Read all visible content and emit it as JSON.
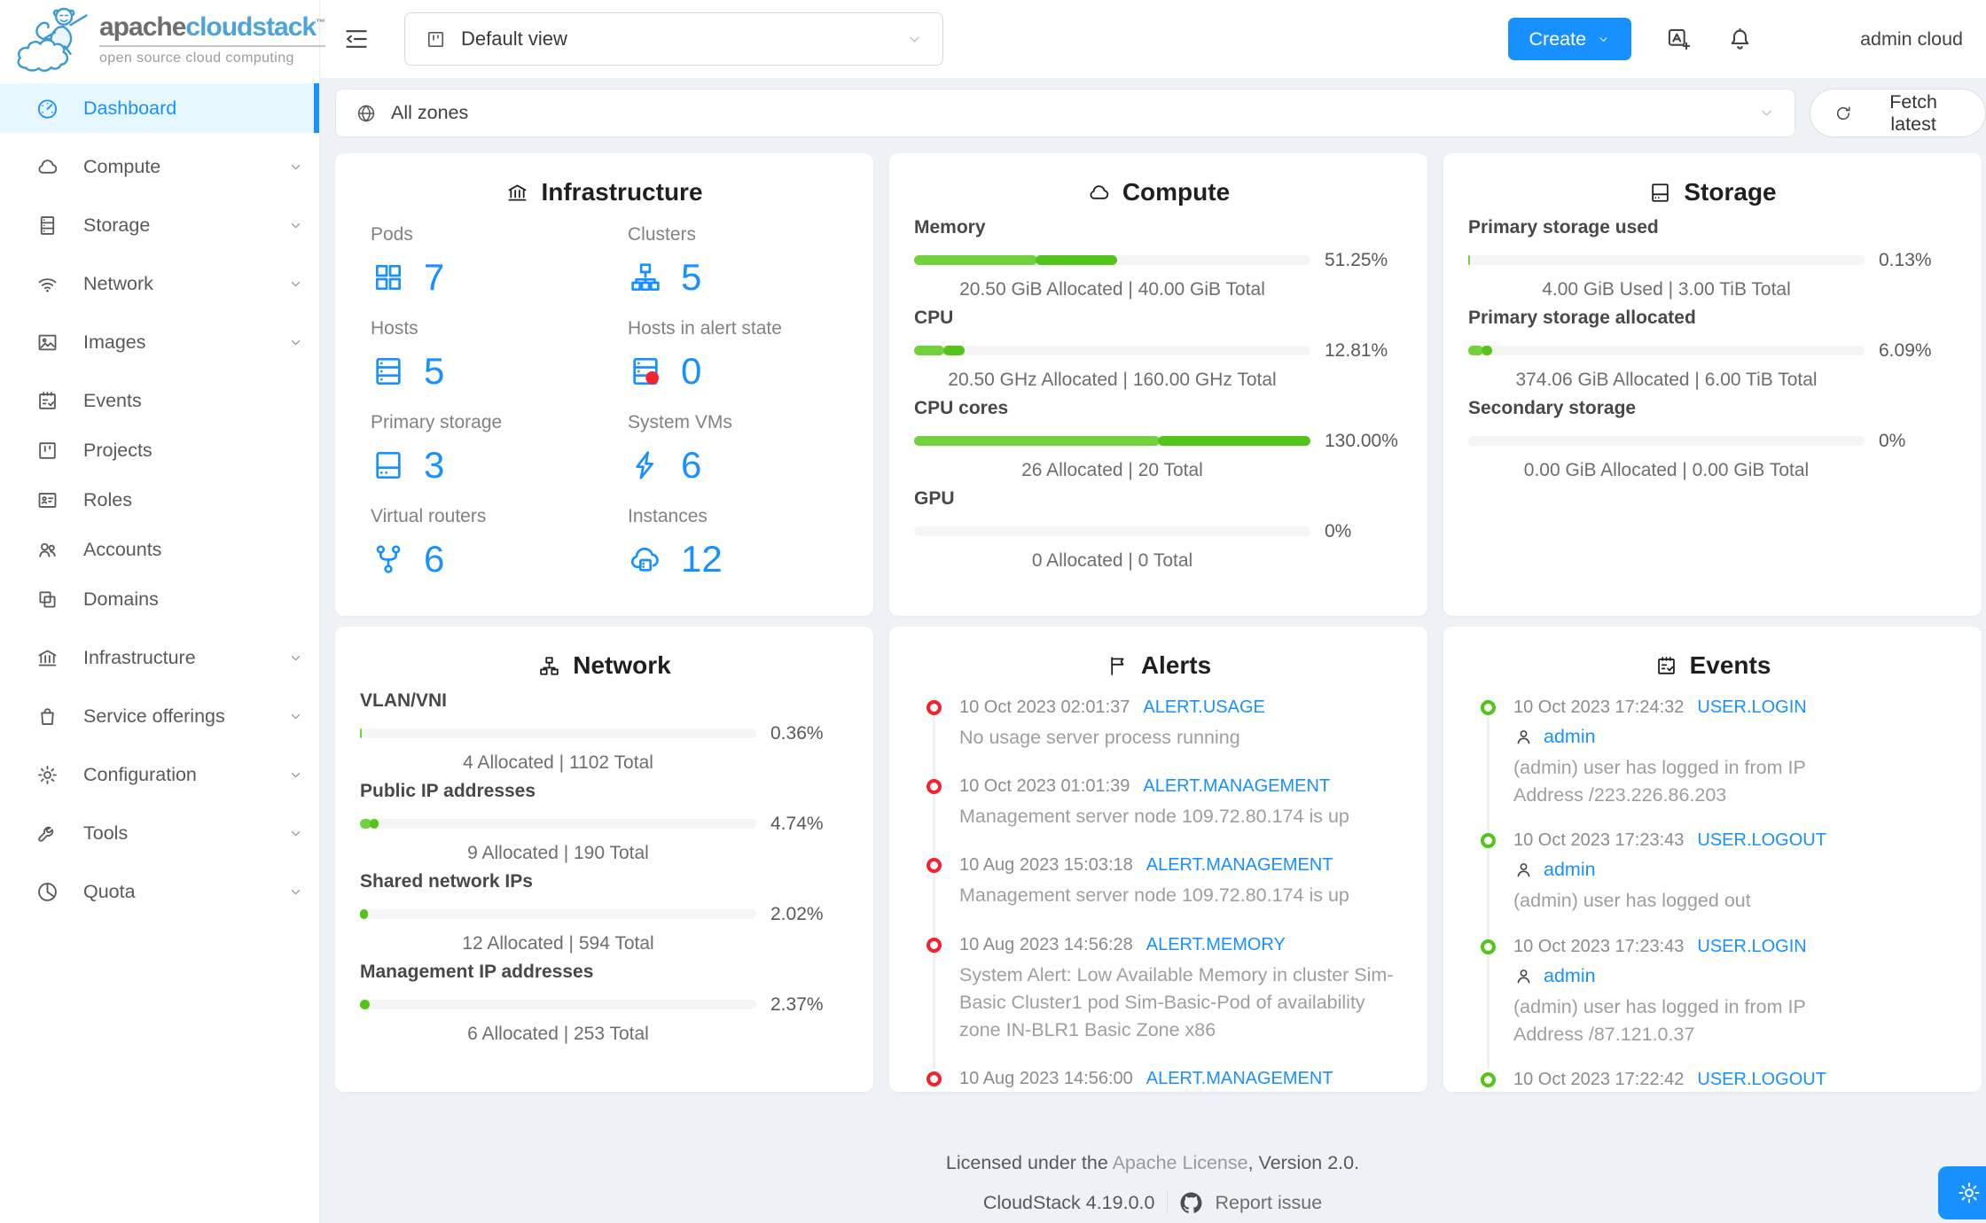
{
  "sidebar": {
    "logo": {
      "brand_primary": "apache",
      "brand_secondary": "cloudstack",
      "trademark": "TM",
      "tagline": "open source cloud computing"
    },
    "items": [
      {
        "label": "Dashboard",
        "icon": "dashboard-icon",
        "active": true
      },
      {
        "label": "Compute",
        "icon": "cloud-icon",
        "chevron": true
      },
      {
        "label": "Storage",
        "icon": "storage-icon",
        "chevron": true
      },
      {
        "label": "Network",
        "icon": "wifi-icon",
        "chevron": true
      },
      {
        "label": "Images",
        "icon": "picture-icon",
        "chevron": true
      },
      {
        "label": "Events",
        "icon": "schedule-icon"
      },
      {
        "label": "Projects",
        "icon": "project-icon"
      },
      {
        "label": "Roles",
        "icon": "idcard-icon"
      },
      {
        "label": "Accounts",
        "icon": "team-icon"
      },
      {
        "label": "Domains",
        "icon": "block-icon"
      },
      {
        "label": "Infrastructure",
        "icon": "bank-icon",
        "chevron": true
      },
      {
        "label": "Service offerings",
        "icon": "shopping-icon",
        "chevron": true
      },
      {
        "label": "Configuration",
        "icon": "gear-icon",
        "chevron": true
      },
      {
        "label": "Tools",
        "icon": "wrench-icon",
        "chevron": true
      },
      {
        "label": "Quota",
        "icon": "pie-icon",
        "chevron": true
      }
    ]
  },
  "header": {
    "view_select": "Default view",
    "create_label": "Create",
    "user_name": "admin cloud"
  },
  "zonebar": {
    "zone_select": "All zones",
    "fetch_label": "Fetch latest"
  },
  "cards": {
    "infrastructure": {
      "title": "Infrastructure",
      "icon": "bank-icon",
      "stats": [
        {
          "label": "Pods",
          "icon": "pods-icon",
          "value": "7"
        },
        {
          "label": "Clusters",
          "icon": "cluster-icon",
          "value": "5"
        },
        {
          "label": "Hosts",
          "icon": "host-icon",
          "value": "5"
        },
        {
          "label": "Hosts in alert state",
          "icon": "host-alert-icon",
          "value": "0"
        },
        {
          "label": "Primary storage",
          "icon": "hdd-icon",
          "value": "3"
        },
        {
          "label": "System VMs",
          "icon": "thunderbolt-icon",
          "value": "6"
        },
        {
          "label": "Virtual routers",
          "icon": "fork-icon",
          "value": "6"
        },
        {
          "label": "Instances",
          "icon": "cloud-server-icon",
          "value": "12"
        }
      ]
    },
    "compute": {
      "title": "Compute",
      "icon": "cloud-icon",
      "sections": [
        {
          "label": "Memory",
          "percent": "51.25%",
          "fill": 51.25,
          "light": 31,
          "caption": "20.50 GiB Allocated | 40.00 GiB Total"
        },
        {
          "label": "CPU",
          "percent": "12.81%",
          "fill": 12.81,
          "light": 7.7,
          "caption": "20.50 GHz Allocated | 160.00 GHz Total"
        },
        {
          "label": "CPU cores",
          "percent": "130.00%",
          "fill": 100,
          "light": 62,
          "caption": "26 Allocated | 20 Total"
        },
        {
          "label": "GPU",
          "percent": "0%",
          "fill": 0,
          "light": 0,
          "caption": "0 Allocated | 0 Total"
        }
      ]
    },
    "storage": {
      "title": "Storage",
      "icon": "hdd-icon",
      "sections": [
        {
          "label": "Primary storage used",
          "percent": "0.13%",
          "fill": 0.4,
          "light": 0.4,
          "caption": "4.00 GiB Used | 3.00 TiB Total"
        },
        {
          "label": "Primary storage allocated",
          "percent": "6.09%",
          "fill": 6.09,
          "light": 3.8,
          "caption": "374.06 GiB Allocated | 6.00 TiB Total"
        },
        {
          "label": "Secondary storage",
          "percent": "0%",
          "fill": 0,
          "light": 0,
          "caption": "0.00 GiB Allocated | 0.00 GiB Total"
        }
      ]
    },
    "network": {
      "title": "Network",
      "icon": "apartment-icon",
      "sections": [
        {
          "label": "VLAN/VNI",
          "percent": "0.36%",
          "fill": 0.5,
          "light": 0.5,
          "caption": "4 Allocated | 1102 Total"
        },
        {
          "label": "Public IP addresses",
          "percent": "4.74%",
          "fill": 4.74,
          "light": 2.9,
          "caption": "9 Allocated | 190 Total"
        },
        {
          "label": "Shared network IPs",
          "percent": "2.02%",
          "fill": 2.02,
          "light": 0,
          "caption": "12 Allocated | 594 Total"
        },
        {
          "label": "Management IP addresses",
          "percent": "2.37%",
          "fill": 2.37,
          "light": 0,
          "caption": "6 Allocated | 253 Total"
        }
      ]
    },
    "alerts": {
      "title": "Alerts",
      "icon": "flag-icon",
      "items": [
        {
          "date": "10 Oct 2023 02:01:37",
          "type": "ALERT.USAGE",
          "desc": "No usage server process running"
        },
        {
          "date": "10 Oct 2023 01:01:39",
          "type": "ALERT.MANAGEMENT",
          "desc": "Management server node 109.72.80.174 is up"
        },
        {
          "date": "10 Aug 2023 15:03:18",
          "type": "ALERT.MANAGEMENT",
          "desc": "Management server node 109.72.80.174 is up"
        },
        {
          "date": "10 Aug 2023 14:56:28",
          "type": "ALERT.MEMORY",
          "desc": "System Alert: Low Available Memory in cluster Sim-Basic Cluster1 pod Sim-Basic-Pod of availability zone IN-BLR1 Basic Zone x86"
        },
        {
          "date": "10 Aug 2023 14:56:00",
          "type": "ALERT.MANAGEMENT",
          "desc": ""
        }
      ]
    },
    "events": {
      "title": "Events",
      "icon": "schedule-icon",
      "items": [
        {
          "date": "10 Oct 2023 17:24:32",
          "type": "USER.LOGIN",
          "user": "admin",
          "desc": "(admin) user has logged in from IP Address /223.226.86.203"
        },
        {
          "date": "10 Oct 2023 17:23:43",
          "type": "USER.LOGOUT",
          "user": "admin",
          "desc": "(admin) user has logged out"
        },
        {
          "date": "10 Oct 2023 17:23:43",
          "type": "USER.LOGIN",
          "user": "admin",
          "desc": "(admin) user has logged in from IP Address /87.121.0.37"
        },
        {
          "date": "10 Oct 2023 17:22:42",
          "type": "USER.LOGOUT",
          "user": "",
          "desc": ""
        }
      ]
    }
  },
  "footer": {
    "license_prefix": "Licensed under the ",
    "license_link": "Apache License",
    "license_suffix": ", Version 2.0.",
    "version": "CloudStack 4.19.0.0",
    "report_issue": "Report issue"
  },
  "colors": {
    "accent": "#1890ff",
    "green_light": "#73d13d",
    "green_dark": "#52c41a",
    "alert_red": "#f5222d",
    "event_green": "#52c41a",
    "active_bg": "#e6f7ff"
  }
}
